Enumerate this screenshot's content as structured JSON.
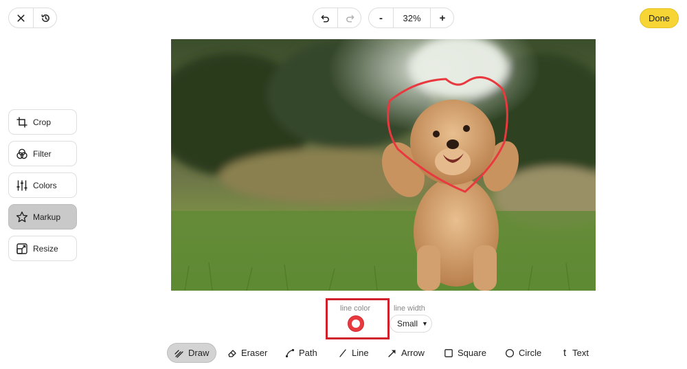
{
  "header": {
    "close_icon": "close-icon",
    "history_icon": "history-icon",
    "undo_icon": "undo-icon",
    "redo_icon": "redo-icon",
    "zoom_out_label": "-",
    "zoom_level": "32%",
    "zoom_in_label": "+",
    "done_label": "Done"
  },
  "sidebar": {
    "items": [
      {
        "label": "Crop",
        "icon": "crop-icon"
      },
      {
        "label": "Filter",
        "icon": "filter-icon"
      },
      {
        "label": "Colors",
        "icon": "sliders-icon"
      },
      {
        "label": "Markup",
        "icon": "star-icon",
        "active": true
      },
      {
        "label": "Resize",
        "icon": "resize-icon"
      }
    ]
  },
  "options": {
    "line_color_label": "line color",
    "line_color_value": "#e8393f",
    "line_width_label": "line width",
    "line_width_value": "Small"
  },
  "tools": [
    {
      "label": "Draw",
      "icon": "draw-icon",
      "active": true
    },
    {
      "label": "Eraser",
      "icon": "eraser-icon"
    },
    {
      "label": "Path",
      "icon": "path-icon"
    },
    {
      "label": "Line",
      "icon": "line-icon"
    },
    {
      "label": "Arrow",
      "icon": "arrow-icon"
    },
    {
      "label": "Square",
      "icon": "square-icon"
    },
    {
      "label": "Circle",
      "icon": "circle-icon"
    },
    {
      "label": "Text",
      "icon": "text-icon",
      "glyph": "t"
    }
  ],
  "colors": {
    "done_bg": "#f7d535",
    "markup_stroke": "#e8393f",
    "highlight": "#d0202b"
  }
}
